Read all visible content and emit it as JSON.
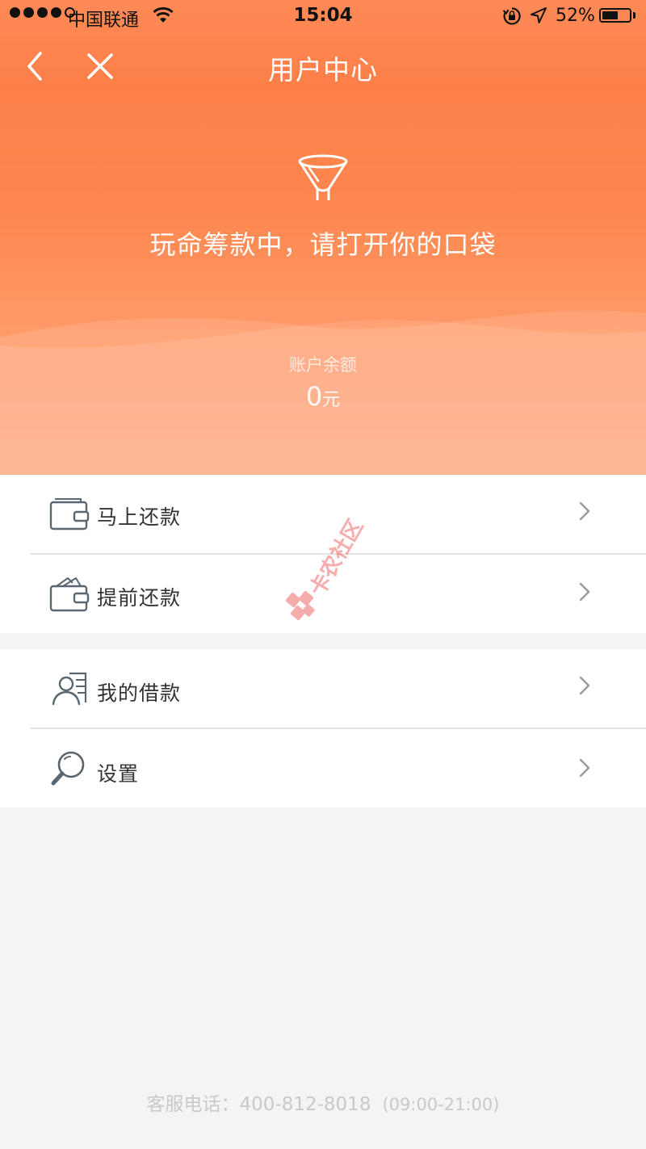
{
  "status_bar": {
    "carrier": "中国联通",
    "time": "15:04",
    "battery": "52%",
    "battery_level": 0.52
  },
  "nav": {
    "title": "用户中心",
    "back_icon": "chevron-left-icon",
    "close_icon": "close-icon"
  },
  "hero": {
    "icon": "funnel-icon",
    "slogan": "玩命筹款中，请打开你的口袋",
    "balance_label": "账户余额",
    "balance_value": "0",
    "balance_unit": "元"
  },
  "menu": {
    "repay_now": "马上还款",
    "repay_early": "提前还款",
    "my_loans": "我的借款",
    "settings": "设置"
  },
  "watermark_text": "卡农社区",
  "footer": {
    "hotline": "客服电话：400-812-8018",
    "hours": "(09:00-21:00)"
  },
  "colors": {
    "accent": "#fd7f48",
    "hero_bottom": "#ffa57b",
    "watermark": "#f26a6a"
  }
}
